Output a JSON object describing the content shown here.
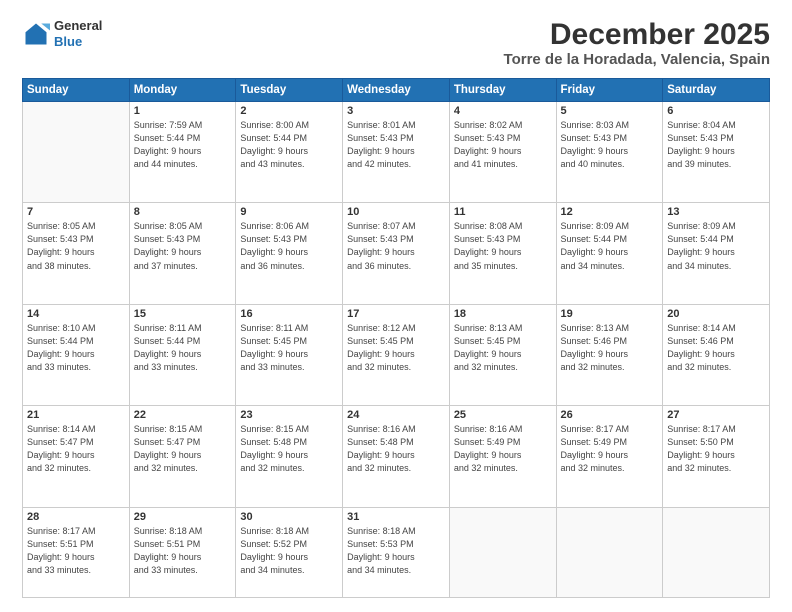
{
  "header": {
    "logo_general": "General",
    "logo_blue": "Blue",
    "title": "December 2025",
    "subtitle": "Torre de la Horadada, Valencia, Spain"
  },
  "calendar": {
    "days_of_week": [
      "Sunday",
      "Monday",
      "Tuesday",
      "Wednesday",
      "Thursday",
      "Friday",
      "Saturday"
    ],
    "weeks": [
      [
        {
          "day": "",
          "info": ""
        },
        {
          "day": "1",
          "info": "Sunrise: 7:59 AM\nSunset: 5:44 PM\nDaylight: 9 hours\nand 44 minutes."
        },
        {
          "day": "2",
          "info": "Sunrise: 8:00 AM\nSunset: 5:44 PM\nDaylight: 9 hours\nand 43 minutes."
        },
        {
          "day": "3",
          "info": "Sunrise: 8:01 AM\nSunset: 5:43 PM\nDaylight: 9 hours\nand 42 minutes."
        },
        {
          "day": "4",
          "info": "Sunrise: 8:02 AM\nSunset: 5:43 PM\nDaylight: 9 hours\nand 41 minutes."
        },
        {
          "day": "5",
          "info": "Sunrise: 8:03 AM\nSunset: 5:43 PM\nDaylight: 9 hours\nand 40 minutes."
        },
        {
          "day": "6",
          "info": "Sunrise: 8:04 AM\nSunset: 5:43 PM\nDaylight: 9 hours\nand 39 minutes."
        }
      ],
      [
        {
          "day": "7",
          "info": "Sunrise: 8:05 AM\nSunset: 5:43 PM\nDaylight: 9 hours\nand 38 minutes."
        },
        {
          "day": "8",
          "info": "Sunrise: 8:05 AM\nSunset: 5:43 PM\nDaylight: 9 hours\nand 37 minutes."
        },
        {
          "day": "9",
          "info": "Sunrise: 8:06 AM\nSunset: 5:43 PM\nDaylight: 9 hours\nand 36 minutes."
        },
        {
          "day": "10",
          "info": "Sunrise: 8:07 AM\nSunset: 5:43 PM\nDaylight: 9 hours\nand 36 minutes."
        },
        {
          "day": "11",
          "info": "Sunrise: 8:08 AM\nSunset: 5:43 PM\nDaylight: 9 hours\nand 35 minutes."
        },
        {
          "day": "12",
          "info": "Sunrise: 8:09 AM\nSunset: 5:44 PM\nDaylight: 9 hours\nand 34 minutes."
        },
        {
          "day": "13",
          "info": "Sunrise: 8:09 AM\nSunset: 5:44 PM\nDaylight: 9 hours\nand 34 minutes."
        }
      ],
      [
        {
          "day": "14",
          "info": "Sunrise: 8:10 AM\nSunset: 5:44 PM\nDaylight: 9 hours\nand 33 minutes."
        },
        {
          "day": "15",
          "info": "Sunrise: 8:11 AM\nSunset: 5:44 PM\nDaylight: 9 hours\nand 33 minutes."
        },
        {
          "day": "16",
          "info": "Sunrise: 8:11 AM\nSunset: 5:45 PM\nDaylight: 9 hours\nand 33 minutes."
        },
        {
          "day": "17",
          "info": "Sunrise: 8:12 AM\nSunset: 5:45 PM\nDaylight: 9 hours\nand 32 minutes."
        },
        {
          "day": "18",
          "info": "Sunrise: 8:13 AM\nSunset: 5:45 PM\nDaylight: 9 hours\nand 32 minutes."
        },
        {
          "day": "19",
          "info": "Sunrise: 8:13 AM\nSunset: 5:46 PM\nDaylight: 9 hours\nand 32 minutes."
        },
        {
          "day": "20",
          "info": "Sunrise: 8:14 AM\nSunset: 5:46 PM\nDaylight: 9 hours\nand 32 minutes."
        }
      ],
      [
        {
          "day": "21",
          "info": "Sunrise: 8:14 AM\nSunset: 5:47 PM\nDaylight: 9 hours\nand 32 minutes."
        },
        {
          "day": "22",
          "info": "Sunrise: 8:15 AM\nSunset: 5:47 PM\nDaylight: 9 hours\nand 32 minutes."
        },
        {
          "day": "23",
          "info": "Sunrise: 8:15 AM\nSunset: 5:48 PM\nDaylight: 9 hours\nand 32 minutes."
        },
        {
          "day": "24",
          "info": "Sunrise: 8:16 AM\nSunset: 5:48 PM\nDaylight: 9 hours\nand 32 minutes."
        },
        {
          "day": "25",
          "info": "Sunrise: 8:16 AM\nSunset: 5:49 PM\nDaylight: 9 hours\nand 32 minutes."
        },
        {
          "day": "26",
          "info": "Sunrise: 8:17 AM\nSunset: 5:49 PM\nDaylight: 9 hours\nand 32 minutes."
        },
        {
          "day": "27",
          "info": "Sunrise: 8:17 AM\nSunset: 5:50 PM\nDaylight: 9 hours\nand 32 minutes."
        }
      ],
      [
        {
          "day": "28",
          "info": "Sunrise: 8:17 AM\nSunset: 5:51 PM\nDaylight: 9 hours\nand 33 minutes."
        },
        {
          "day": "29",
          "info": "Sunrise: 8:18 AM\nSunset: 5:51 PM\nDaylight: 9 hours\nand 33 minutes."
        },
        {
          "day": "30",
          "info": "Sunrise: 8:18 AM\nSunset: 5:52 PM\nDaylight: 9 hours\nand 34 minutes."
        },
        {
          "day": "31",
          "info": "Sunrise: 8:18 AM\nSunset: 5:53 PM\nDaylight: 9 hours\nand 34 minutes."
        },
        {
          "day": "",
          "info": ""
        },
        {
          "day": "",
          "info": ""
        },
        {
          "day": "",
          "info": ""
        }
      ]
    ]
  }
}
